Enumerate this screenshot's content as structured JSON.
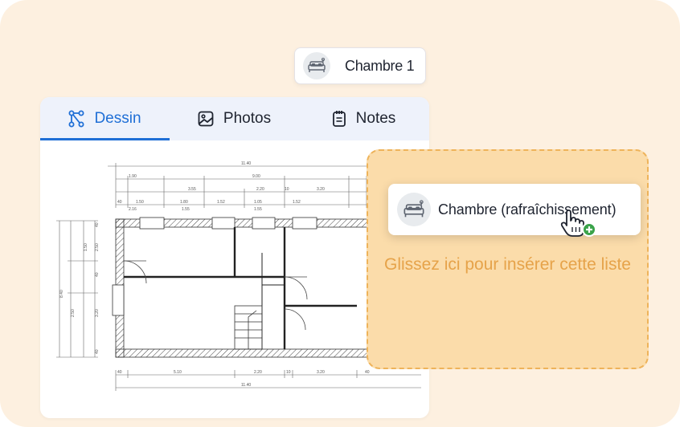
{
  "room_chip": {
    "label": "Chambre 1",
    "icon": "bed-icon"
  },
  "tabs": [
    {
      "label": "Dessin",
      "icon": "drawing-icon",
      "active": true
    },
    {
      "label": "Photos",
      "icon": "image-icon",
      "active": false
    },
    {
      "label": "Notes",
      "icon": "notepad-icon",
      "active": false
    }
  ],
  "floor_plan": {
    "dimensions_top": [
      "11.40",
      "1.90",
      "9.00",
      "3.55",
      "2.20",
      "10",
      "3.20",
      "40",
      "1.50",
      "1.80",
      "1.52",
      "1.05",
      "1.52",
      "2.16",
      "1.55",
      "1.55"
    ],
    "dimensions_bottom": [
      "40",
      "5.10",
      "2.20",
      "10",
      "3.20",
      "40",
      "11.40"
    ],
    "dimensions_left": [
      "40",
      "2.50",
      "1.50",
      "40",
      "2.50",
      "3.20",
      "40",
      "8.40"
    ]
  },
  "drop_zone": {
    "hint": "Glissez ici pour insérer cette liste",
    "colors": {
      "fill": "#fbdcaa",
      "border": "#eeb35a",
      "text": "#e6a34a"
    }
  },
  "drag_chip": {
    "label": "Chambre (rafraîchissement)",
    "icon": "bed-icon"
  },
  "colors": {
    "accent": "#1f6fd6",
    "background": "#fdf0e0",
    "add_badge": "#3aa34a"
  }
}
